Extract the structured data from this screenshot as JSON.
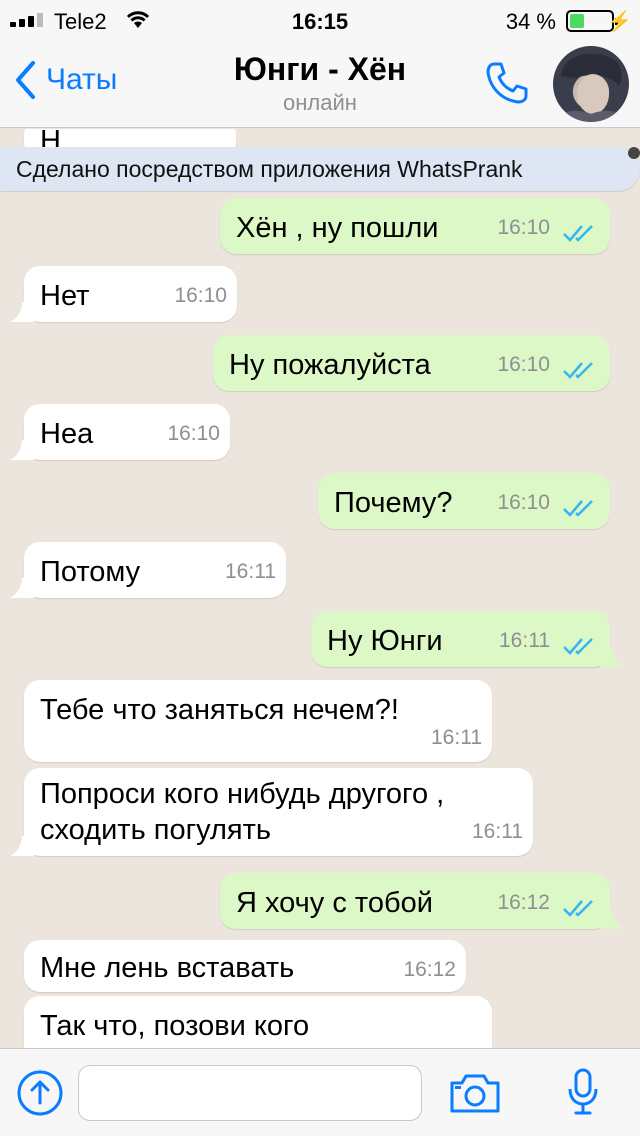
{
  "status_bar": {
    "carrier": "Tele2",
    "time": "16:15",
    "battery_percent": "34 %",
    "battery_level": 0.34
  },
  "header": {
    "back_label": "Чаты",
    "contact_name": "Юнги - Хён",
    "contact_status": "онлайн"
  },
  "banner": "Сделано посредством приложения WhatsPrank",
  "partial_top": "Н",
  "messages": [
    {
      "dir": "out",
      "text": "Хён , ну пошли",
      "time": "16:10"
    },
    {
      "dir": "in",
      "text": "Нет",
      "time": "16:10"
    },
    {
      "dir": "out",
      "text": "Ну пожалуйста",
      "time": "16:10"
    },
    {
      "dir": "in",
      "text": "Неа",
      "time": "16:10"
    },
    {
      "dir": "out",
      "text": "Почему?",
      "time": "16:10"
    },
    {
      "dir": "in",
      "text": "Потому",
      "time": "16:11"
    },
    {
      "dir": "out",
      "text": "Ну Юнги",
      "time": "16:11"
    },
    {
      "dir": "in",
      "text": "Тебе что заняться нечем?!",
      "time": "16:11"
    },
    {
      "dir": "in",
      "text_line1": "Попроси кого нибудь другого ,",
      "text_line2": "сходить погулять",
      "time": "16:11"
    },
    {
      "dir": "out",
      "text": "Я хочу с тобой",
      "time": "16:12"
    },
    {
      "dir": "in",
      "text": "Мне лень вставать",
      "time": "16:12"
    },
    {
      "dir": "in",
      "text": "Так что, позови кого",
      "time": ""
    }
  ],
  "input": {
    "placeholder": ""
  },
  "colors": {
    "accent": "#0A7CFF",
    "outgoing": "#DCF8C6",
    "incoming": "#FFFFFF",
    "chat_bg": "#ECE5DD",
    "ticks": "#34B7F1"
  },
  "icons": [
    "back-chevron-icon",
    "phone-icon",
    "upload-icon",
    "camera-icon",
    "microphone-icon",
    "double-check-icon"
  ]
}
